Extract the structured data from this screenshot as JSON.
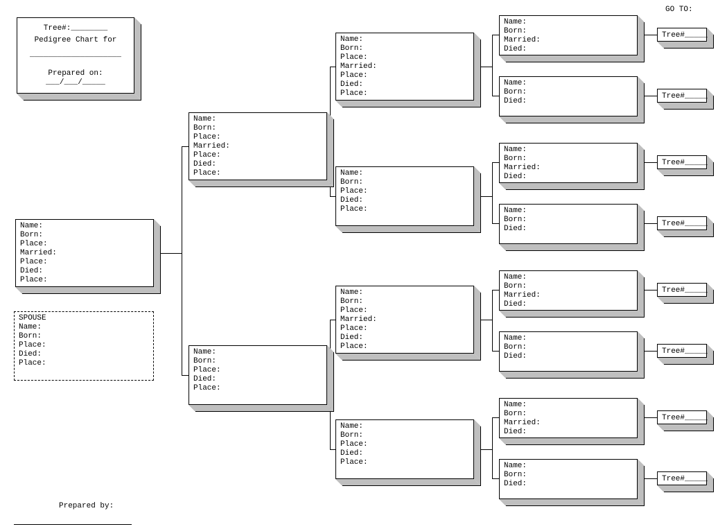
{
  "header": {
    "goto": "GO TO:",
    "tree_hash": "Tree#:________",
    "title": "Pedigree Chart for",
    "name_line": "____________________",
    "prepared_on": "Prepared on: ___/___/_____"
  },
  "full_fields": {
    "name": "Name:",
    "born": "Born:",
    "place": "Place:",
    "married": "Married:",
    "place2": "Place:",
    "died": "Died:",
    "place3": "Place:"
  },
  "mother_fields": {
    "name": "Name:",
    "born": "Born:",
    "place": "Place:",
    "blank": " ",
    "died": "Died:",
    "place3": "Place:"
  },
  "gp_married": {
    "name": "Name:",
    "born": "Born:",
    "married": "Married:",
    "died": "Died:"
  },
  "gp_plain": {
    "name": "Name:",
    "blank": " ",
    "born": "Born:",
    "died": "Died:"
  },
  "spouse": {
    "title": "SPOUSE",
    "name": "Name:",
    "blank": " ",
    "born": "Born:",
    "place": "Place:",
    "died": "Died:",
    "place2": "Place:"
  },
  "treeref": "Tree#_____",
  "prepared_by": "Prepared by:"
}
